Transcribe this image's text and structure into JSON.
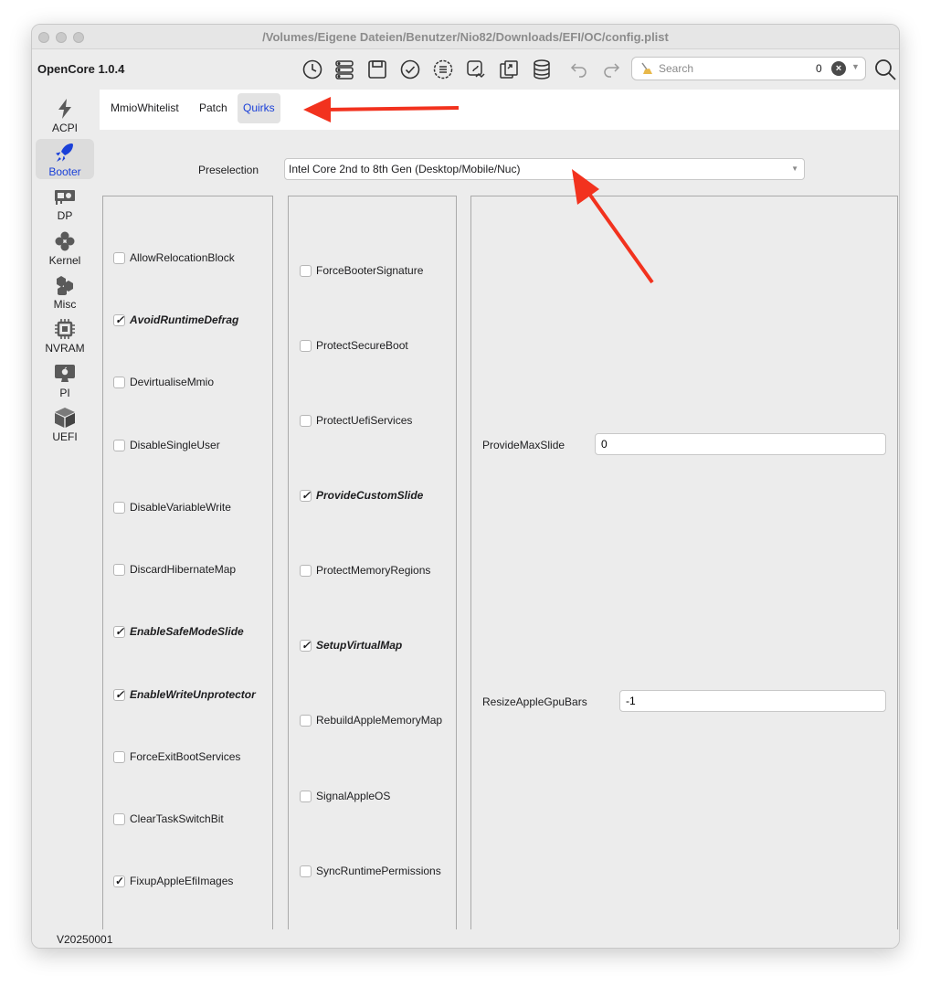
{
  "window": {
    "title": "/Volumes/Eigene Dateien/Benutzer/Nio82/Downloads/EFI/OC/config.plist"
  },
  "toolbar": {
    "app_name": "OpenCore 1.0.4",
    "icons": [
      "clock-icon",
      "list-icon",
      "save-icon",
      "checkmark-circle-icon",
      "list-circle-icon",
      "patch-icon",
      "share-icon",
      "database-icon",
      "undo-icon",
      "redo-icon"
    ],
    "search_placeholder": "Search",
    "search_count": "0"
  },
  "sidebar": {
    "items": [
      {
        "label": "ACPI",
        "icon": "bolt-icon",
        "active": false
      },
      {
        "label": "Booter",
        "icon": "rocket-icon",
        "active": true
      },
      {
        "label": "DP",
        "icon": "gpu-card-icon",
        "active": false
      },
      {
        "label": "Kernel",
        "icon": "kernel-icon",
        "active": false
      },
      {
        "label": "Misc",
        "icon": "hexagons-icon",
        "active": false
      },
      {
        "label": "NVRAM",
        "icon": "chip-icon",
        "active": false
      },
      {
        "label": "PI",
        "icon": "apple-monitor-icon",
        "active": false
      },
      {
        "label": "UEFI",
        "icon": "cube-icon",
        "active": false
      }
    ]
  },
  "tabs": [
    {
      "label": "MmioWhitelist",
      "active": false
    },
    {
      "label": "Patch",
      "active": false
    },
    {
      "label": "Quirks",
      "active": true
    }
  ],
  "preselection": {
    "label": "Preselection",
    "value": "Intel Core 2nd to 8th Gen (Desktop/Mobile/Nuc)"
  },
  "quirks_col1": [
    {
      "label": "AllowRelocationBlock",
      "checked": false
    },
    {
      "label": "AvoidRuntimeDefrag",
      "checked": true
    },
    {
      "label": "DevirtualiseMmio",
      "checked": false
    },
    {
      "label": "DisableSingleUser",
      "checked": false
    },
    {
      "label": "DisableVariableWrite",
      "checked": false
    },
    {
      "label": "DiscardHibernateMap",
      "checked": false
    },
    {
      "label": "EnableSafeModeSlide",
      "checked": true
    },
    {
      "label": "EnableWriteUnprotector",
      "checked": true
    },
    {
      "label": "ForceExitBootServices",
      "checked": false
    },
    {
      "label": "ClearTaskSwitchBit",
      "checked": false
    },
    {
      "label": "FixupAppleEfiImages",
      "checked": true
    }
  ],
  "quirks_col2": [
    {
      "label": "ForceBooterSignature",
      "checked": false
    },
    {
      "label": "ProtectSecureBoot",
      "checked": false
    },
    {
      "label": "ProtectUefiServices",
      "checked": false
    },
    {
      "label": "ProvideCustomSlide",
      "checked": true
    },
    {
      "label": "ProtectMemoryRegions",
      "checked": false
    },
    {
      "label": "SetupVirtualMap",
      "checked": true
    },
    {
      "label": "RebuildAppleMemoryMap",
      "checked": false
    },
    {
      "label": "SignalAppleOS",
      "checked": false
    },
    {
      "label": "SyncRuntimePermissions",
      "checked": false
    }
  ],
  "fields": {
    "provide_max_slide": {
      "label": "ProvideMaxSlide",
      "value": "0"
    },
    "resize_apple_gpu_bars": {
      "label": "ResizeAppleGpuBars",
      "value": "-1"
    }
  },
  "status": {
    "version": "V20250001"
  },
  "colors": {
    "accent": "#1a40d8",
    "annotation_arrow": "#f2321e"
  }
}
